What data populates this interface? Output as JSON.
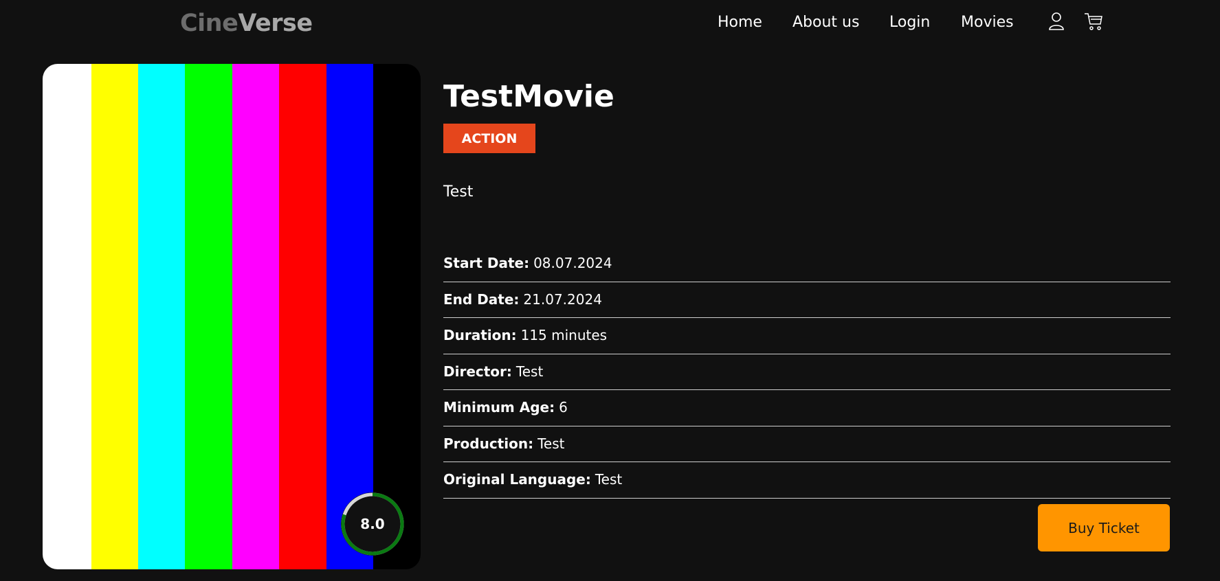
{
  "header": {
    "logo_part1": "Cine",
    "logo_part2": "Verse",
    "nav": [
      "Home",
      "About us",
      "Login",
      "Movies"
    ],
    "icons": [
      "user-icon",
      "cart-icon"
    ]
  },
  "poster": {
    "color_bars": [
      "#ffffff",
      "#ffff00",
      "#00ffff",
      "#00ff00",
      "#ff00ff",
      "#ff0000",
      "#0000ff",
      "#000000"
    ],
    "rating": "8.0",
    "rating_fraction": 0.8,
    "rating_color": "#0a7a12"
  },
  "movie": {
    "title": "TestMovie",
    "genre": "ACTION",
    "genre_color": "#e5461c",
    "description": "Test",
    "details": [
      {
        "label": "Start Date:",
        "value": "08.07.2024"
      },
      {
        "label": "End Date:",
        "value": "21.07.2024"
      },
      {
        "label": "Duration:",
        "value": "115 minutes"
      },
      {
        "label": "Director:",
        "value": "Test"
      },
      {
        "label": "Minimum Age:",
        "value": "6"
      },
      {
        "label": "Production:",
        "value": "Test"
      },
      {
        "label": "Original Language:",
        "value": "Test"
      }
    ]
  },
  "actions": {
    "buy_label": "Buy Ticket",
    "buy_color": "#ff9500"
  }
}
